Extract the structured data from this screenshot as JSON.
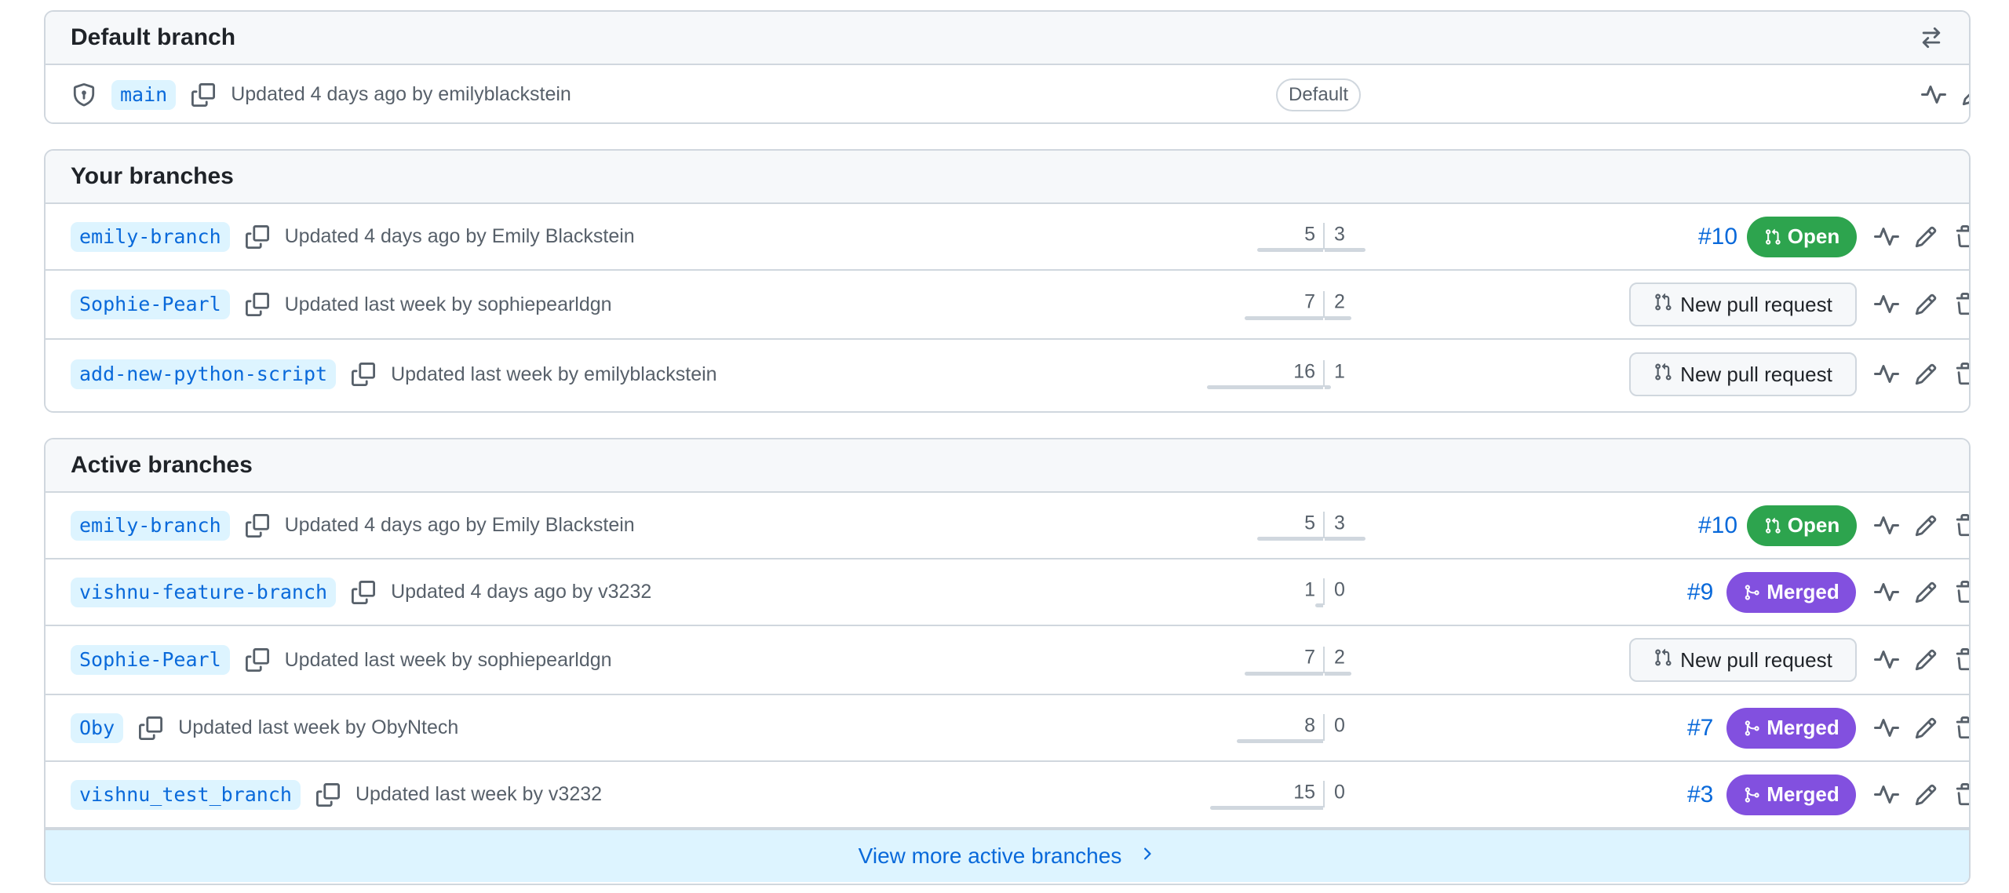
{
  "default_section": {
    "title": "Default branch",
    "branch": {
      "name": "main",
      "updated": "Updated 4 days ago by emilyblackstein",
      "label": "Default"
    }
  },
  "your_section": {
    "title": "Your branches",
    "branches": [
      {
        "name": "emily-branch",
        "updated": "Updated 4 days ago by Emily Blackstein",
        "behind": "5",
        "ahead": "3",
        "pr_number": "#10",
        "pr_status": "Open"
      },
      {
        "name": "Sophie-Pearl",
        "updated": "Updated last week by sophiepearldgn",
        "behind": "7",
        "ahead": "2",
        "new_pr_label": "New pull request"
      },
      {
        "name": "add-new-python-script",
        "updated": "Updated last week by emilyblackstein",
        "behind": "16",
        "ahead": "1",
        "new_pr_label": "New pull request"
      }
    ]
  },
  "active_section": {
    "title": "Active branches",
    "branches": [
      {
        "name": "emily-branch",
        "updated": "Updated 4 days ago by Emily Blackstein",
        "behind": "5",
        "ahead": "3",
        "pr_number": "#10",
        "pr_status": "Open"
      },
      {
        "name": "vishnu-feature-branch",
        "updated": "Updated 4 days ago by v3232",
        "behind": "1",
        "ahead": "0",
        "pr_number": "#9",
        "pr_status": "Merged"
      },
      {
        "name": "Sophie-Pearl",
        "updated": "Updated last week by sophiepearldgn",
        "behind": "7",
        "ahead": "2",
        "new_pr_label": "New pull request"
      },
      {
        "name": "Oby",
        "updated": "Updated last week by ObyNtech",
        "behind": "8",
        "ahead": "0",
        "pr_number": "#7",
        "pr_status": "Merged"
      },
      {
        "name": "vishnu_test_branch",
        "updated": "Updated last week by v3232",
        "behind": "15",
        "ahead": "0",
        "pr_number": "#3",
        "pr_status": "Merged"
      }
    ],
    "view_more_label": "View more active branches"
  },
  "colors": {
    "accent": "#0969da",
    "open": "#2da44e",
    "merged": "#8250df",
    "border": "#d0d7de"
  }
}
